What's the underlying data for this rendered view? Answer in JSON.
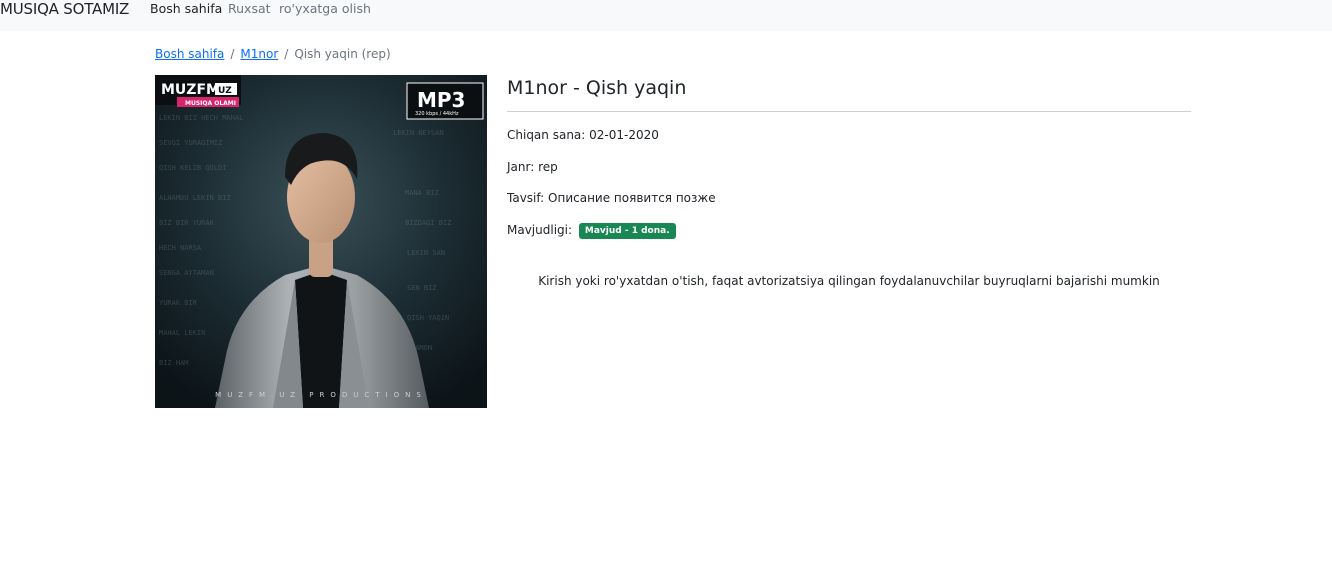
{
  "navbar": {
    "brand": "MUSIQA SOTAMIZ",
    "links": [
      "Bosh sahifa",
      "Ruxsat",
      "ro'yxatga olish"
    ]
  },
  "breadcrumb": {
    "items": [
      "Bosh sahifa",
      "M1nor"
    ],
    "separator": "/",
    "active": "Qish yaqin (rep)"
  },
  "cover": {
    "logo_text": "MUZFM",
    "logo_domain": "UZ",
    "logo_sub": "MUSIQA OLAMI",
    "format": "MP3",
    "format_sub": "320 kbps / 44kHz",
    "footer": "MUZFM.UZ PRODUCTIONS"
  },
  "product": {
    "title": "M1nor - Qish yaqin",
    "release": "Chiqan sana: 02-01-2020",
    "genre": "Janr: rep",
    "description": "Tavsif: Описание появится позже",
    "availability_label": "Mavjudligi:",
    "availability_badge": "Mavjud - 1 dona.",
    "login_notice": "Kirish yoki ro'yxatdan o'tish, faqat avtorizatsiya qilingan foydalanuvchilar buyruqlarni bajarishi mumkin"
  },
  "colors": {
    "navbar_bg": "#f8f9fa",
    "link": "#0d6efd",
    "badge_green": "#198754",
    "muted": "#6c757d"
  }
}
